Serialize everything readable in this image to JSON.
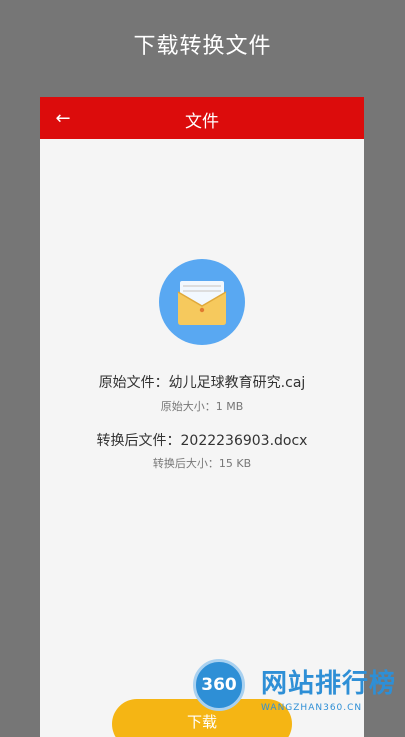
{
  "page_heading": "下载转换文件",
  "appbar": {
    "title": "文件",
    "back_icon": "arrow-left-icon"
  },
  "file_icon": "envelope-icon",
  "original_file": {
    "label": "原始文件：幼儿足球教育研究.caj",
    "size": "原始大小：1 MB"
  },
  "converted_file": {
    "label": "转换后文件：2022236903.docx",
    "size": "转换后大小：15 KB"
  },
  "download_label": "下载",
  "watermark": {
    "logo_text": "360",
    "title": "网站排行榜",
    "subtitle": "WANGZHAN360.CN"
  },
  "colors": {
    "accent": "#dc0c0c",
    "button": "#f5b514",
    "icon_circle": "#59a8f2",
    "watermark": "#2e8fd6"
  }
}
